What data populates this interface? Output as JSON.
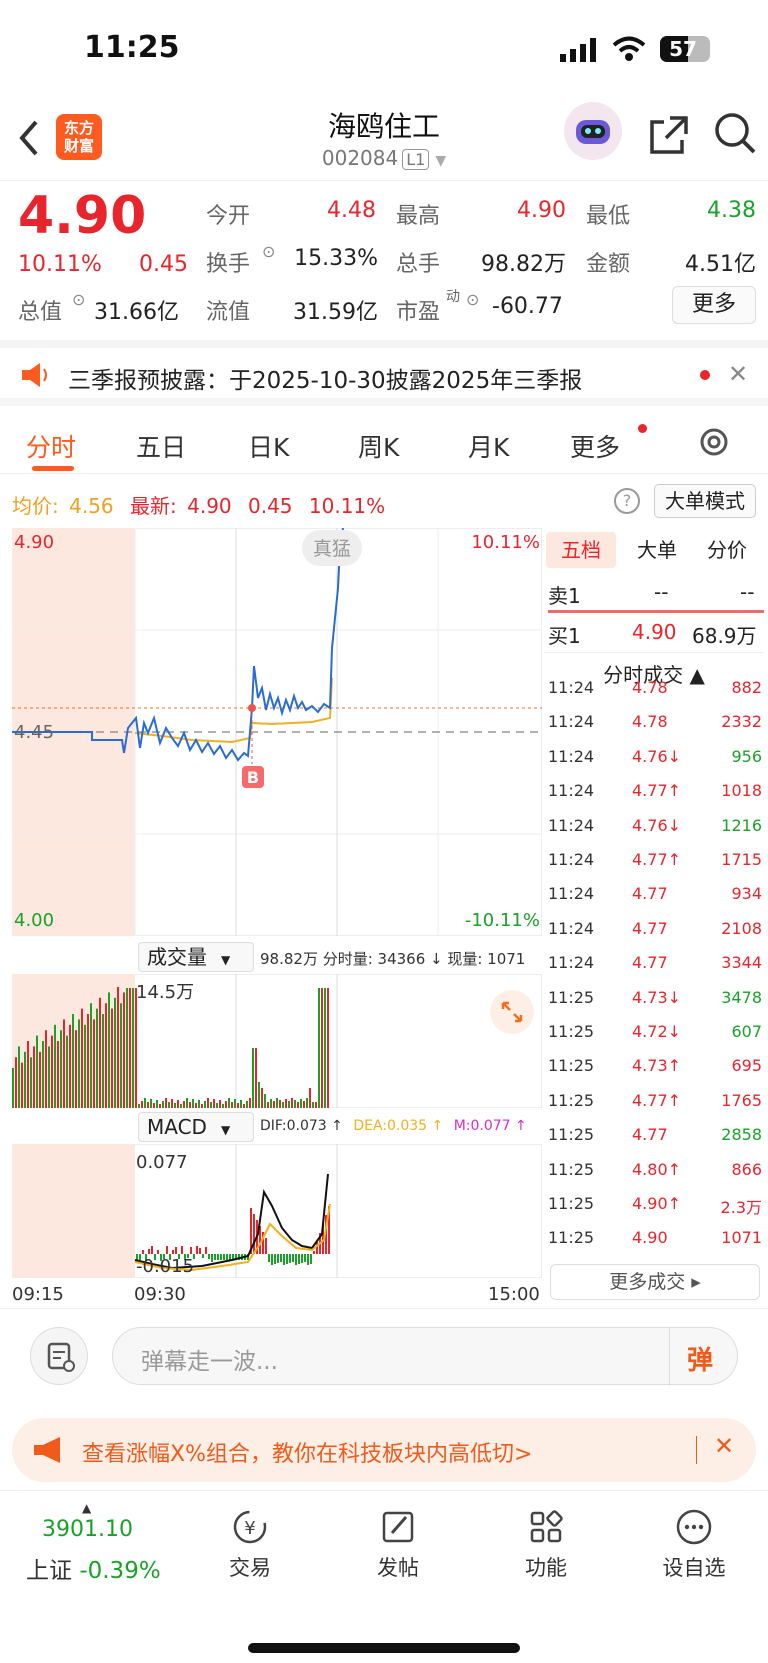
{
  "status": {
    "time": "11:25",
    "battery": "57"
  },
  "header": {
    "title": "海鸥住工",
    "code": "002084",
    "level": "L1",
    "logo_line1": "东方",
    "logo_line2": "财富"
  },
  "quote": {
    "price": "4.90",
    "pct": "10.11%",
    "chg": "0.45",
    "open_label": "今开",
    "open": "4.48",
    "high_label": "最高",
    "high": "4.90",
    "low_label": "最低",
    "low": "4.38",
    "turnover_label": "换手",
    "turnover": "15.33%",
    "vol_label": "总手",
    "vol": "98.82万",
    "amount_label": "金额",
    "amount": "4.51亿",
    "mcap_label": "总值",
    "mcap": "31.66亿",
    "float_label": "流值",
    "float": "31.59亿",
    "pe_label": "市盈",
    "pe_sup": "动",
    "pe": "-60.77",
    "more": "更多"
  },
  "notice": {
    "text": "三季报预披露：于2025-10-30披露2025年三季报"
  },
  "tabs": [
    "分时",
    "五日",
    "日K",
    "周K",
    "月K",
    "更多"
  ],
  "info": {
    "avg_label": "均价:",
    "avg": "4.56",
    "latest_label": "最新:",
    "latest": "4.90",
    "chg": "0.45",
    "pct": "10.11%",
    "mode": "大单模式"
  },
  "chart": {
    "ymax": "4.90",
    "ymid": "4.45",
    "ymin": "4.00",
    "pmax": "10.11%",
    "pmin": "-10.11%",
    "tag": "真猛",
    "marker": "B",
    "vol_title": "成交量",
    "vol_info": "98.82万 分时量: 34366 ↓ 现量: 1071",
    "vol_max": "14.5万",
    "macd_title": "MACD",
    "dif": "DIF:0.073 ↑",
    "dea": "DEA:0.035 ↑",
    "m": "M:0.077 ↑",
    "macd_max": "0.077",
    "macd_min": "-0.015",
    "t_start": "09:15",
    "t_open": "09:30",
    "t_end": "15:00"
  },
  "chart_data": {
    "type": "line",
    "title": "",
    "price_range": [
      4.0,
      4.9
    ],
    "pre_close": 4.45,
    "last": 4.9,
    "avg": 4.56
  },
  "book": {
    "tabs": [
      "五档",
      "大单",
      "分价"
    ],
    "sell1_label": "卖1",
    "sell1_price": "--",
    "sell1_vol": "--",
    "buy1_label": "买1",
    "buy1_price": "4.90",
    "buy1_vol": "68.9万",
    "ticks_title": "分时成交 ▲",
    "more": "更多成交 ▸"
  },
  "ticks": [
    {
      "t": "11:24",
      "p": "4.78",
      "v": "882",
      "vc": "red",
      "pc": "red"
    },
    {
      "t": "11:24",
      "p": "4.78",
      "v": "2332",
      "vc": "red",
      "pc": "red"
    },
    {
      "t": "11:24",
      "p": "4.76↓",
      "v": "956",
      "vc": "green",
      "pc": "red"
    },
    {
      "t": "11:24",
      "p": "4.77↑",
      "v": "1018",
      "vc": "red",
      "pc": "red"
    },
    {
      "t": "11:24",
      "p": "4.76↓",
      "v": "1216",
      "vc": "green",
      "pc": "red"
    },
    {
      "t": "11:24",
      "p": "4.77↑",
      "v": "1715",
      "vc": "red",
      "pc": "red"
    },
    {
      "t": "11:24",
      "p": "4.77",
      "v": "934",
      "vc": "red",
      "pc": "red"
    },
    {
      "t": "11:24",
      "p": "4.77",
      "v": "2108",
      "vc": "red",
      "pc": "red"
    },
    {
      "t": "11:24",
      "p": "4.77",
      "v": "3344",
      "vc": "red",
      "pc": "red"
    },
    {
      "t": "11:25",
      "p": "4.73↓",
      "v": "3478",
      "vc": "green",
      "pc": "red"
    },
    {
      "t": "11:25",
      "p": "4.72↓",
      "v": "607",
      "vc": "green",
      "pc": "red"
    },
    {
      "t": "11:25",
      "p": "4.73↑",
      "v": "695",
      "vc": "red",
      "pc": "red"
    },
    {
      "t": "11:25",
      "p": "4.77↑",
      "v": "1765",
      "vc": "red",
      "pc": "red"
    },
    {
      "t": "11:25",
      "p": "4.77",
      "v": "2858",
      "vc": "green",
      "pc": "red"
    },
    {
      "t": "11:25",
      "p": "4.80↑",
      "v": "866",
      "vc": "red",
      "pc": "red"
    },
    {
      "t": "11:25",
      "p": "4.90↑",
      "v": "2.3万",
      "vc": "red",
      "pc": "red"
    },
    {
      "t": "11:25",
      "p": "4.90",
      "v": "1071",
      "vc": "red",
      "pc": "red"
    }
  ],
  "comment": {
    "placeholder": "弹幕走一波...",
    "btn": "弹"
  },
  "promo": {
    "text": "查看涨幅X%组合，教你在科技板块内高低切>"
  },
  "bottom": {
    "index": "3901.10",
    "index_name": "上证",
    "index_chg": "-0.39%",
    "nav": [
      "交易",
      "发帖",
      "功能",
      "设自选"
    ]
  }
}
